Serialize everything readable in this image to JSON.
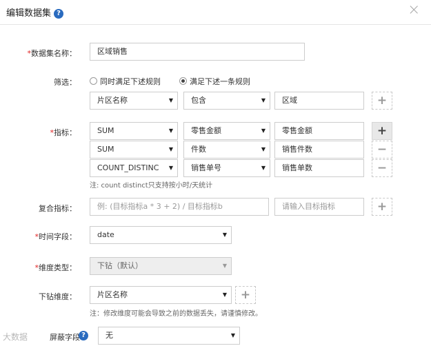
{
  "dialog": {
    "title": "编辑数据集",
    "help_glyph": "?",
    "close_glyph": "×"
  },
  "name_field": {
    "label": "数据集名称：",
    "value": "区域销售"
  },
  "filter": {
    "label": "筛选：",
    "option_all": "同时满足下述规则",
    "option_any": "满足下述一条规则",
    "selected": "满足下述一条规则",
    "rule": {
      "field": "片区名称",
      "operator": "包含",
      "value": "区域"
    }
  },
  "metrics": {
    "label": "指标：",
    "rows": [
      {
        "aggregation": "SUM",
        "field": "零售金额",
        "alias": "零售金额"
      },
      {
        "aggregation": "SUM",
        "field": "件数",
        "alias": "销售件数"
      },
      {
        "aggregation": "COUNT_DISTINC",
        "field": "销售单号",
        "alias": "销售单数"
      }
    ],
    "note": "注: count distinct只支持按小时/天统计"
  },
  "composite": {
    "label": "复合指标：",
    "formula_placeholder": "例: (目标指标a * 3  + 2) / 目标指标b",
    "target_placeholder": "请输入目标指标"
  },
  "time_field": {
    "label": "时间字段：",
    "value": "date"
  },
  "dimension_type": {
    "label": "维度类型：",
    "value": "下钻（默认）"
  },
  "drill_dimension": {
    "label": "下钻维度：",
    "value": "片区名称",
    "note": "注：修改维度可能会导致之前的数据丢失，请谨慎修改。"
  },
  "shield_field": {
    "label": "屏蔽字段：",
    "value": "无"
  },
  "icons": {
    "plus": "+",
    "minus": "−",
    "caret": "▼"
  },
  "watermark": "大数据"
}
